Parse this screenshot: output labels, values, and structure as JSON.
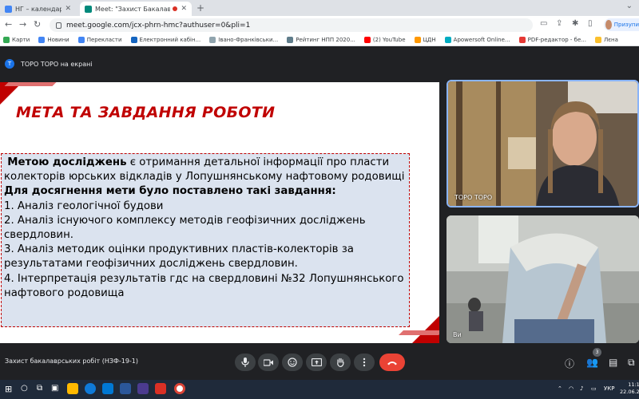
{
  "browser": {
    "tabs": [
      {
        "label": "НГ – календар - Тиждень",
        "active": false
      },
      {
        "label": "Meet: \"Захист Бакалаврськ\"",
        "active": true
      }
    ],
    "new_tab": "+",
    "url": "meet.google.com/jcx-phrn-hmc?authuser=0&pli=1",
    "profile_label": "Призупи"
  },
  "bookmarks": [
    {
      "label": "Карти",
      "color": "#34a853"
    },
    {
      "label": "Новини",
      "color": "#4285f4"
    },
    {
      "label": "Перекласти",
      "color": "#4285f4"
    },
    {
      "label": "Електронний кабін...",
      "color": "#1565c0"
    },
    {
      "label": "Івано-Франківськи...",
      "color": "#90a4ae"
    },
    {
      "label": "Рейтинг НПП 2020...",
      "color": "#607d8b"
    },
    {
      "label": "(2) YouTube",
      "color": "#ff0000"
    },
    {
      "label": "ЦДН",
      "color": "#ff9800"
    },
    {
      "label": "Apowersoft Online...",
      "color": "#00acc1"
    },
    {
      "label": "PDF-редактор - бе...",
      "color": "#e53935"
    },
    {
      "label": "Лєна",
      "color": "#fbc02d"
    }
  ],
  "meet": {
    "presenter_initial": "Т",
    "presenter_label": "TOPO TOPO на екрані",
    "slide": {
      "title": "МЕТА ТА ЗАВДАННЯ РОБОТИ",
      "intro_bold": "Метою досліджень",
      "intro_rest": " є отримання детальної інформації про пласти колекторів юрських відкладів у Лопушнянському нафтовому родовищі",
      "tasks_heading": "Для досягнення мети було поставлено такі завдання:",
      "tasks": [
        "1. Аналіз геологічної будови",
        "2. Аналіз існуючого комплексу методів геофізичних досліджень свердловин.",
        "3. Аналіз методик оцінки продуктивних пластів-колекторів за результатами геофізичних досліджень свердловин.",
        "4. Інтерпретація результатів гдс на  свердловині №32 Лопушнянського нафтового родовища"
      ]
    },
    "participants": [
      {
        "name": "TOPO TOPO"
      },
      {
        "name": "Ви"
      }
    ],
    "meeting_name": "Захист бакалаврських робіт (НЗФ-19-1)",
    "people_count": "3"
  },
  "taskbar": {
    "language": "УКР",
    "time": "11:1",
    "date": "22.06.2"
  },
  "colors": {
    "slide_accent": "#c00000",
    "content_box_bg": "#dbe3ef",
    "end_call": "#ea4335"
  }
}
